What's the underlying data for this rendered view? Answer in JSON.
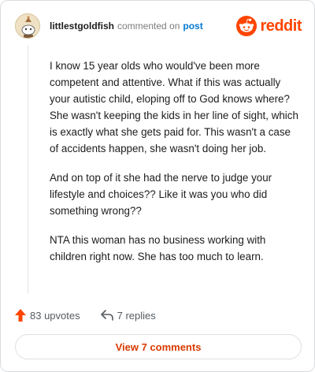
{
  "header": {
    "username": "littlestgoldfish",
    "action": "commented on",
    "post_link": "post",
    "brand": "reddit",
    "brand_color": "#ff4500",
    "avatar_icon": "snoo-avatar-icon"
  },
  "comment": {
    "paragraphs": [
      "I know 15 year olds who would've been more competent and attentive. What if this was actually your autistic child, eloping off to God knows where? She wasn't keeping the kids in her line of sight, which is exactly what she gets paid for. This wasn't a case of accidents happen, she wasn't doing her job.",
      "And on top of it she had the nerve to judge your lifestyle and choices?? Like it was you who did something wrong??",
      "NTA this woman has no business working with children right now. She has too much to learn."
    ]
  },
  "actions": {
    "upvotes_label": "83 upvotes",
    "upvote_icon": "upvote-arrow-icon",
    "upvote_color": "#ff4500",
    "replies_label": "7 replies",
    "reply_icon": "reply-arrow-icon"
  },
  "footer": {
    "view_comments_label": "View 7 comments",
    "accent_color": "#d93a00"
  }
}
